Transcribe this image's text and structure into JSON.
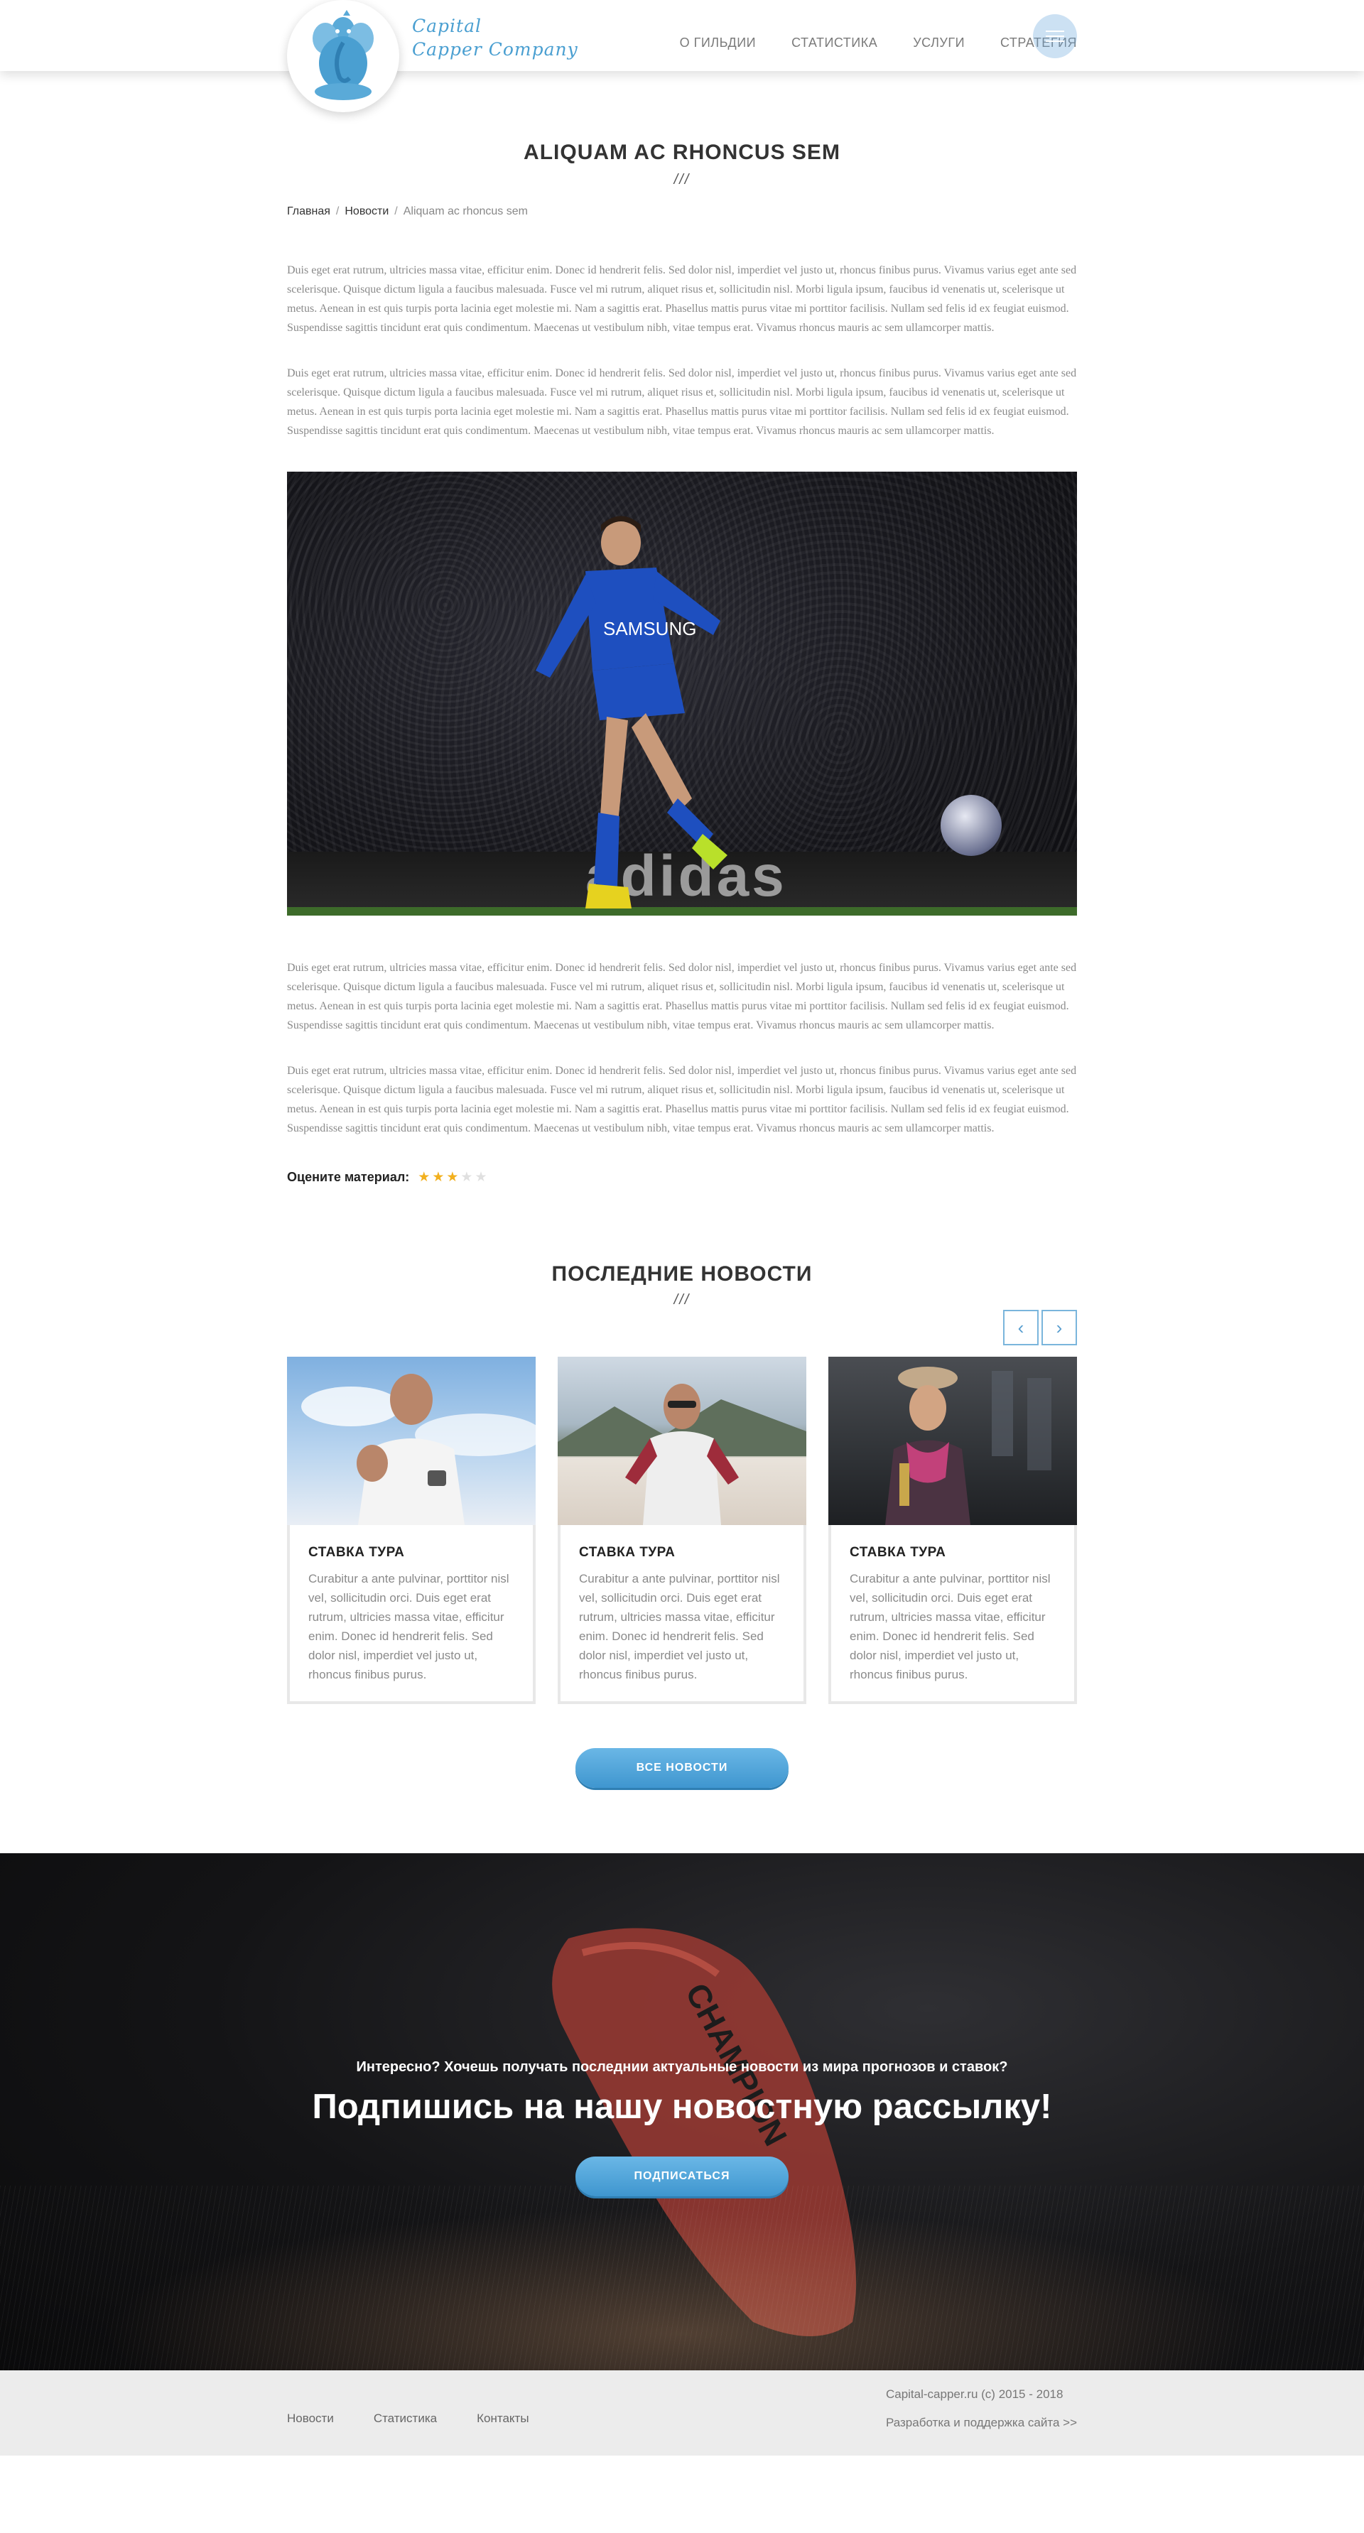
{
  "header": {
    "logo_line1": "Capital",
    "logo_line2": "Capper Company",
    "nav": [
      "О ГИЛЬДИИ",
      "СТАТИСТИКА",
      "УСЛУГИ",
      "СТРАТЕГИЯ"
    ]
  },
  "article": {
    "title": "ALIQUAM AC RHONCUS SEM",
    "title_deco": "///",
    "breadcrumb": {
      "home": "Главная",
      "section": "Новости",
      "current": "Aliquam ac rhoncus sem"
    },
    "paragraph": "Duis eget erat rutrum, ultricies massa vitae, efficitur enim. Donec id hendrerit felis. Sed dolor nisl, imperdiet vel justo ut, rhoncus finibus purus. Vivamus varius eget ante sed scelerisque. Quisque dictum ligula a faucibus malesuada. Fusce vel mi rutrum, aliquet risus et, sollicitudin nisl. Morbi ligula ipsum, faucibus id venenatis ut, scelerisque ut metus. Aenean in est quis turpis porta lacinia eget molestie mi. Nam a sagittis erat. Phasellus mattis purus vitae mi porttitor facilisis. Nullam sed felis id ex feugiat euismod. Suspendisse sagittis tincidunt erat quis condimentum. Maecenas ut vestibulum nibh, vitae tempus erat. Vivamus rhoncus mauris ac sem ullamcorper mattis.",
    "image_ad_text": "adidas",
    "rating_label": "Оцените материал:",
    "rating": 3,
    "rating_max": 5
  },
  "news": {
    "title": "ПОСЛЕДНИЕ НОВОСТИ",
    "title_deco": "///",
    "prev_icon": "‹",
    "next_icon": "›",
    "cards": [
      {
        "title": "СТАВКА ТУРА",
        "text": "Curabitur a ante pulvinar, porttitor nisl vel, sollicitudin orci. Duis eget erat rutrum, ultricies massa vitae, efficitur enim. Donec id hendrerit felis. Sed dolor nisl, imperdiet vel justo ut, rhoncus finibus purus."
      },
      {
        "title": "СТАВКА ТУРА",
        "text": "Curabitur a ante pulvinar, porttitor nisl vel, sollicitudin orci. Duis eget erat rutrum, ultricies massa vitae, efficitur enim. Donec id hendrerit felis. Sed dolor nisl, imperdiet vel justo ut, rhoncus finibus purus."
      },
      {
        "title": "СТАВКА ТУРА",
        "text": "Curabitur a ante pulvinar, porttitor nisl vel, sollicitudin orci. Duis eget erat rutrum, ultricies massa vitae, efficitur enim. Donec id hendrerit felis. Sed dolor nisl, imperdiet vel justo ut, rhoncus finibus purus."
      }
    ],
    "all_news_label": "ВСЕ НОВОСТИ"
  },
  "subscribe": {
    "small": "Интересно? Хочешь получать последнии актуальные новости из мира прогнозов и ставок?",
    "big": "Подпишись на нашу новостную рассылку!",
    "button": "ПОДПИСАТЬСЯ",
    "boot_text": "CHAMPION"
  },
  "footer": {
    "links": [
      "Новости",
      "Статистика",
      "Контакты"
    ],
    "copyright": "Capital-capper.ru (c) 2015 - 2018",
    "dev": "Разработка и поддержка сайта >>"
  },
  "colors": {
    "accent": "#4a9fd1",
    "star": "#f2b01e",
    "footer_bg": "#ececec"
  }
}
